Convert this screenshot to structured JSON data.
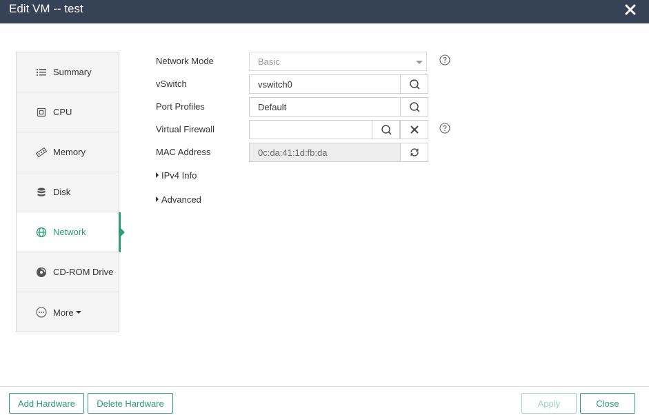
{
  "window": {
    "title": "Edit VM -- test"
  },
  "sidebar": {
    "items": [
      {
        "label": "Summary",
        "icon": "list-icon"
      },
      {
        "label": "CPU",
        "icon": "cpu-icon"
      },
      {
        "label": "Memory",
        "icon": "memory-icon"
      },
      {
        "label": "Disk",
        "icon": "disk-icon"
      },
      {
        "label": "Network",
        "icon": "globe-icon",
        "active": true
      },
      {
        "label": "CD-ROM Drive",
        "icon": "cdrom-icon"
      },
      {
        "label": "More",
        "icon": "more-icon"
      }
    ]
  },
  "form": {
    "network_mode": {
      "label": "Network Mode",
      "value": "Basic"
    },
    "vswitch": {
      "label": "vSwitch",
      "value": "vswitch0"
    },
    "port_profiles": {
      "label": "Port Profiles",
      "value": "Default"
    },
    "virtual_firewall": {
      "label": "Virtual Firewall",
      "value": ""
    },
    "mac_address": {
      "label": "MAC Address",
      "value": "0c:da:41:1d:fb:da"
    },
    "ipv4_info": "IPv4 Info",
    "advanced": "Advanced"
  },
  "footer": {
    "add_hardware": "Add Hardware",
    "delete_hardware": "Delete Hardware",
    "apply": "Apply",
    "close": "Close"
  },
  "colors": {
    "titlebar": "#364256",
    "accent": "#2a9d76"
  }
}
